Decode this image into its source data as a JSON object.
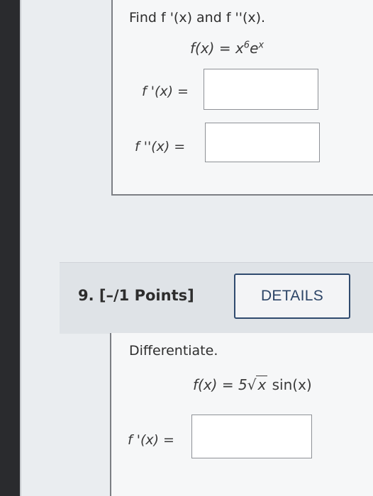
{
  "problem8": {
    "prompt": "Find f '(x) and f ''(x).",
    "function_lhs": "f(x) = x",
    "function_exp": "6",
    "function_rest": "e",
    "function_rest_exp": "x",
    "first_derivative_label": "f '(x) =",
    "second_derivative_label": "f ''(x) =",
    "first_derivative_value": "",
    "second_derivative_value": ""
  },
  "problem9": {
    "number_label": "9.",
    "points_label": "[–/1 Points]",
    "details_button": "DETAILS",
    "prompt": "Differentiate.",
    "function_lhs": "f(x) = 5",
    "sqrt_symbol": "√",
    "sqrt_arg": "x",
    "function_rest": " sin(x)",
    "derivative_label": "f '(x) =",
    "derivative_value": ""
  }
}
